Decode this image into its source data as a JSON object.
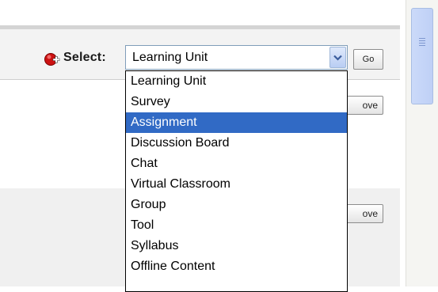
{
  "toolbar": {
    "select_label": "Select:",
    "selected_value": "Learning Unit",
    "go_label": "Go"
  },
  "dropdown": {
    "options": [
      "Learning Unit",
      "Survey",
      "Assignment",
      "Discussion Board",
      "Chat",
      "Virtual Classroom",
      "Group",
      "Tool",
      "Syllabus",
      "Offline Content"
    ],
    "highlighted": "Assignment"
  },
  "row_buttons": {
    "remove_1_label": "ove",
    "remove_2_label": "ove"
  },
  "colors": {
    "highlight": "#316ac5",
    "icon_red": "#cc1111"
  },
  "icons": {
    "add": "add-icon",
    "arrow": "chevron-down-icon"
  }
}
